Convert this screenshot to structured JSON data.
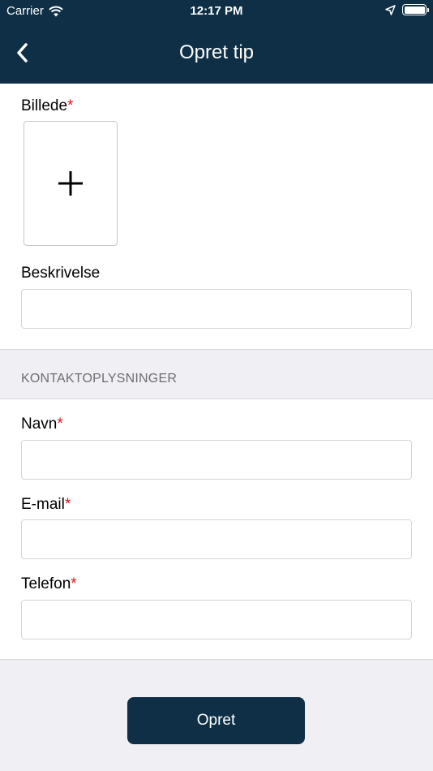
{
  "status_bar": {
    "carrier": "Carrier",
    "time": "12:17 PM",
    "wifi_icon": "wifi-icon",
    "location_icon": "location-arrow-icon",
    "battery_icon": "battery-full-icon"
  },
  "nav": {
    "title": "Opret tip",
    "back_icon": "chevron-left-icon"
  },
  "form": {
    "image": {
      "label": "Billede",
      "required_mark": "*",
      "add_icon": "plus-icon"
    },
    "description": {
      "label": "Beskrivelse",
      "value": "",
      "placeholder": ""
    },
    "contact_section_title": "KONTAKTOPLYSNINGER",
    "name": {
      "label": "Navn",
      "required_mark": "*",
      "value": "",
      "placeholder": ""
    },
    "email": {
      "label": "E-mail",
      "required_mark": "*",
      "value": "",
      "placeholder": ""
    },
    "phone": {
      "label": "Telefon",
      "required_mark": "*",
      "value": "",
      "placeholder": ""
    }
  },
  "submit_label": "Opret",
  "colors": {
    "header_bg": "#0e2f45",
    "required": "#e0131a",
    "page_bg": "#efeff4",
    "section_header_text": "#6d6d72"
  }
}
